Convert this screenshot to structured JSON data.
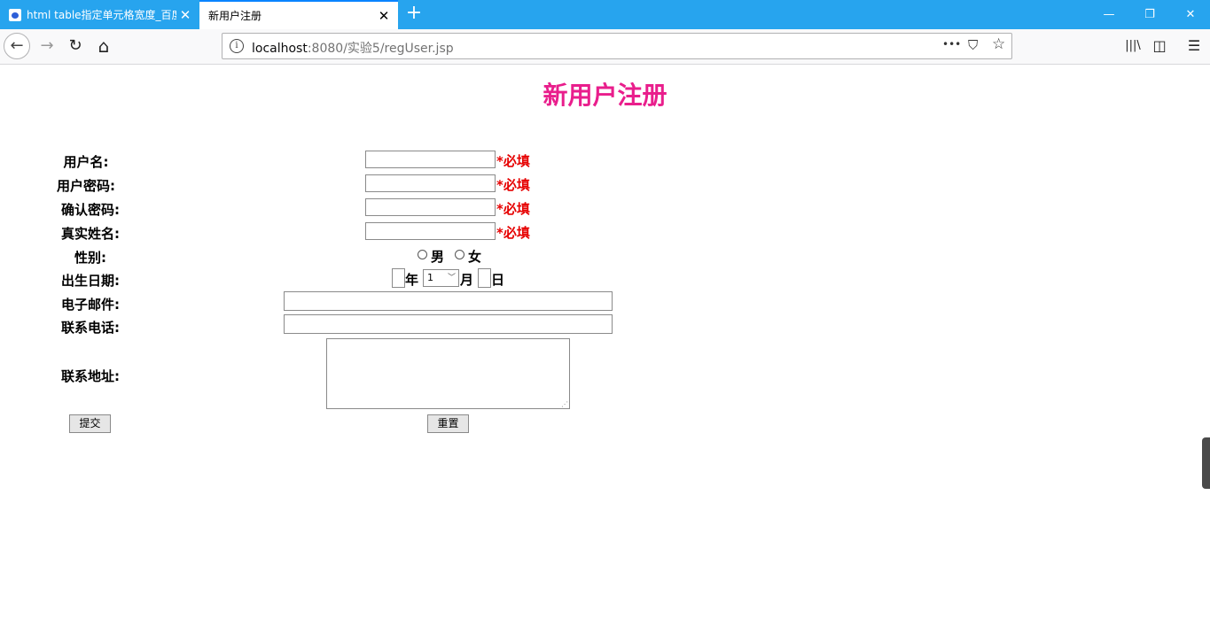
{
  "browser": {
    "tabs": [
      {
        "title": "html table指定单元格宽度_百度",
        "active": false
      },
      {
        "title": "新用户注册",
        "active": true
      }
    ],
    "new_tab_icon": "plus-icon",
    "window_controls": {
      "minimize": "—",
      "restore": "❐",
      "close": "✕"
    },
    "nav": {
      "back": "←",
      "forward": "→",
      "reload": "↻",
      "home": "⌂"
    },
    "url": {
      "host": "localhost",
      "rest": ":8080/实验5/regUser.jsp"
    },
    "toolbar_icons": {
      "more": "•••",
      "pocket": "⛉",
      "bookmark": "☆",
      "library": "|||\\",
      "sidebar": "◫",
      "menu": "☰"
    }
  },
  "page": {
    "title": "新用户注册",
    "fields": {
      "username": {
        "label": "用户名:",
        "value": ""
      },
      "password": {
        "label": "用户密码:",
        "value": ""
      },
      "confirm_password": {
        "label": "确认密码:",
        "value": ""
      },
      "real_name": {
        "label": "真实姓名:",
        "value": ""
      },
      "gender": {
        "label": "性别:",
        "options": [
          "男",
          "女"
        ],
        "selected": null
      },
      "birthdate": {
        "label": "出生日期:",
        "year_value": "",
        "year_unit": "年",
        "month_value": "1",
        "month_unit": "月",
        "day_value": "",
        "day_unit": "日"
      },
      "email": {
        "label": "电子邮件:",
        "value": ""
      },
      "phone": {
        "label": "联系电话:",
        "value": ""
      },
      "address": {
        "label": "联系地址:",
        "value": ""
      }
    },
    "required_mark": "*必填",
    "buttons": {
      "submit": "提交",
      "reset": "重置"
    }
  },
  "colors": {
    "tabbar": "#27a4ee",
    "title": "#e91e8c",
    "required": "#e60000"
  }
}
